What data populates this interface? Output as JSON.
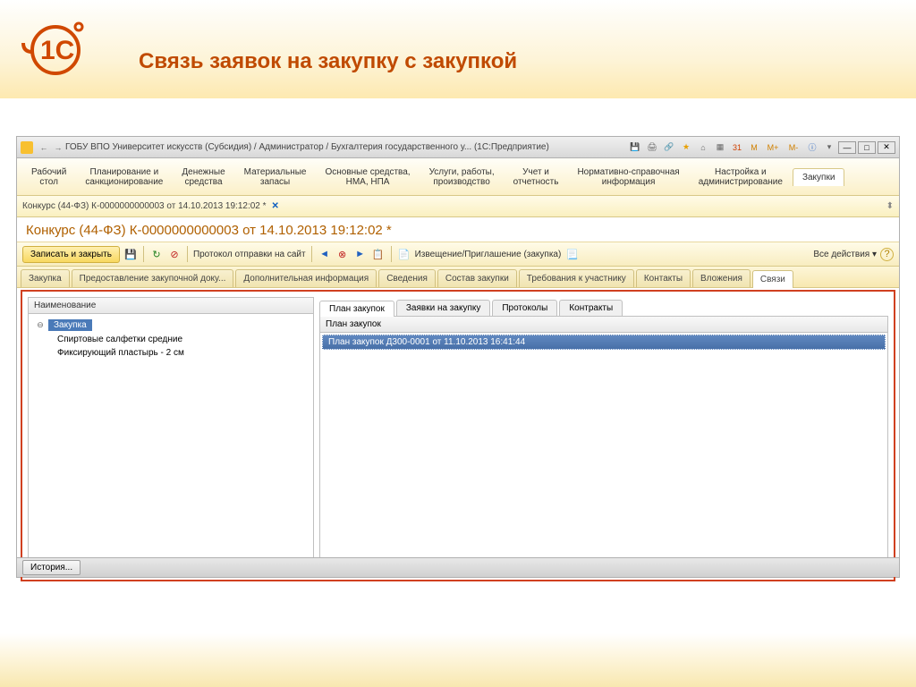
{
  "slide": {
    "title": "Связь заявок на закупку с закупкой"
  },
  "titlebar": {
    "text": "ГОБУ ВПО Университет искусств (Субсидия) / Администратор / Бухгалтерия государственного у... (1С:Предприятие)",
    "nav_back": "←",
    "nav_fwd": "→",
    "m1": "M",
    "m2": "M+",
    "m3": "M-"
  },
  "sections": [
    "Рабочий\nстол",
    "Планирование и\nсанкционирование",
    "Денежные\nсредства",
    "Материальные\nзапасы",
    "Основные средства,\nНМА, НПА",
    "Услуги, работы,\nпроизводство",
    "Учет и\nотчетность",
    "Нормативно-справочная\nинформация",
    "Настройка и\nадминистрирование",
    "Закупки"
  ],
  "doctab": {
    "text": "Конкурс (44-ФЗ) К-0000000000003 от 14.10.2013 19:12:02 *",
    "close": "✕"
  },
  "doc_title": "Конкурс (44-ФЗ) К-0000000000003 от 14.10.2013 19:12:02 *",
  "toolbar": {
    "save_close": "Записать и закрыть",
    "protocol": "Протокол отправки на сайт",
    "notice": "Извещение/Приглашение (закупка)",
    "all_actions": "Все действия ▾",
    "help": "?"
  },
  "form_tabs": [
    "Закупка",
    "Предоставление закупочной доку...",
    "Дополнительная информация",
    "Сведения",
    "Состав закупки",
    "Требования к участнику",
    "Контакты",
    "Вложения",
    "Связи"
  ],
  "left": {
    "header": "Наименование",
    "root": "Закупка",
    "children": [
      "Спиртовые салфетки средние",
      "Фиксирующий пластырь - 2 см"
    ]
  },
  "sub_tabs": [
    "План закупок",
    "Заявки на закупку",
    "Протоколы",
    "Контракты"
  ],
  "right": {
    "header": "План закупок",
    "item": "План закупок Д300-0001 от 11.10.2013 16:41:44"
  },
  "status": {
    "history": "История..."
  }
}
